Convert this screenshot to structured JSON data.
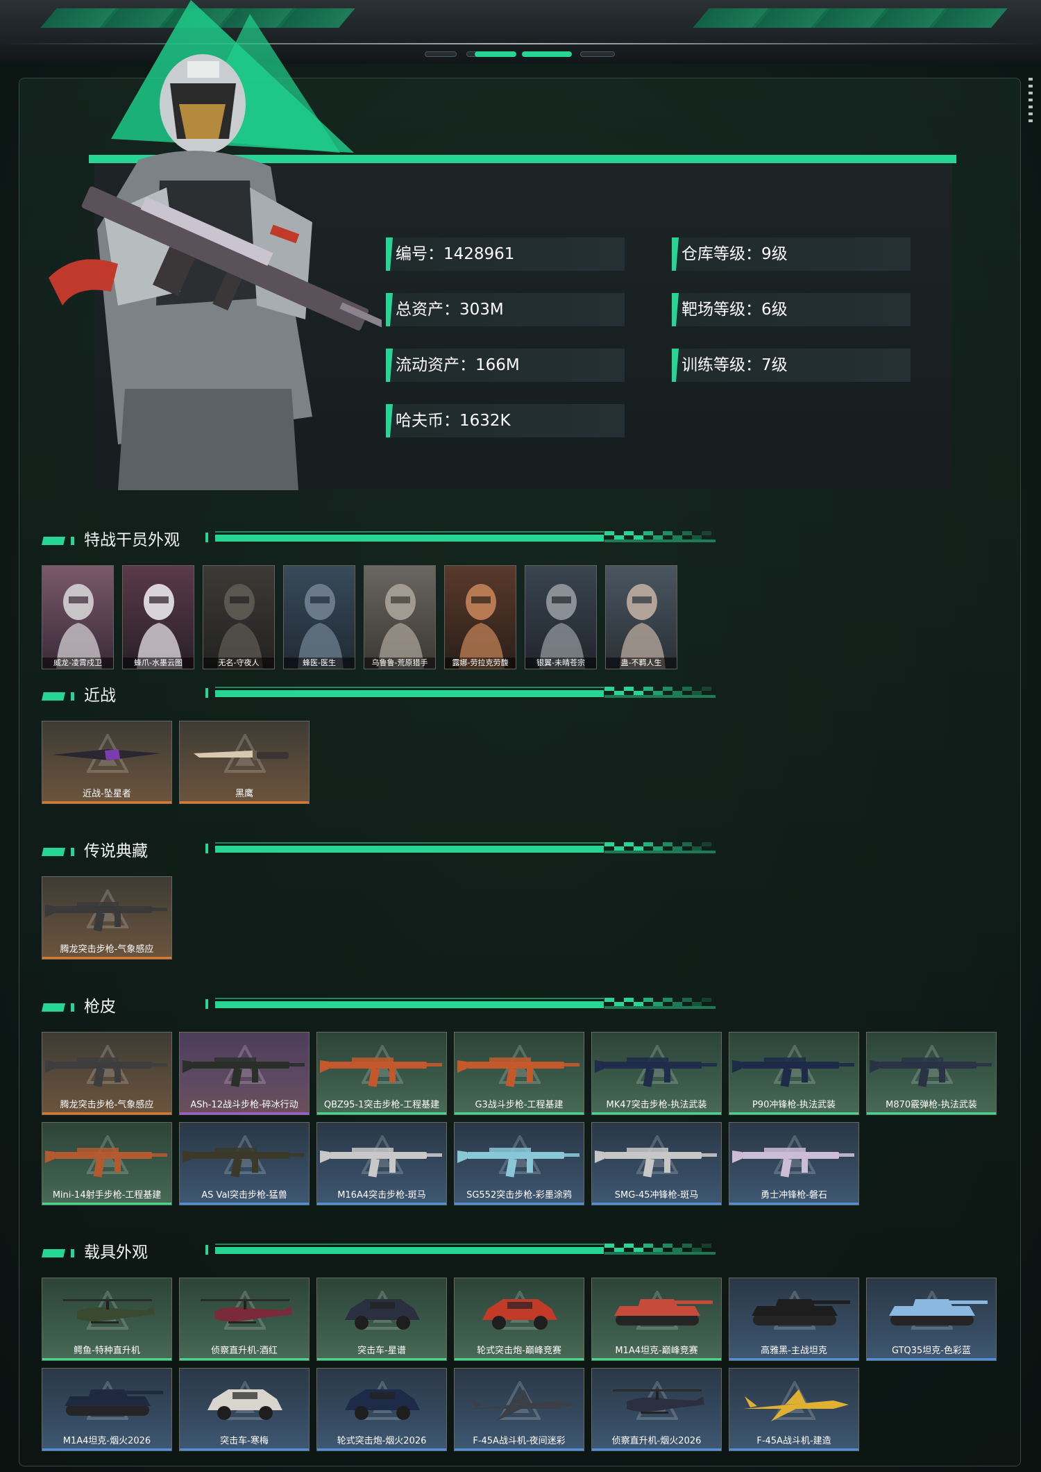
{
  "profile": {
    "stats": [
      {
        "label": "编号：1428961"
      },
      {
        "label": "仓库等级：9级"
      },
      {
        "label": "总资产：303M"
      },
      {
        "label": "靶场等级：6级"
      },
      {
        "label": "流动资产：166M"
      },
      {
        "label": "训练等级：7级"
      },
      {
        "label": "哈夫币：1632K"
      }
    ]
  },
  "sections": {
    "operators": {
      "title": "特战干员外观",
      "items": [
        "威龙-凌霄戍卫",
        "蜂爪-水墨云图",
        "无名-守夜人",
        "蜂医-医生",
        "乌鲁鲁-荒原猎手",
        "露娜-劳拉克劳馥",
        "银翼-未晴苍宗",
        "蛊-不羁人生"
      ]
    },
    "melee": {
      "title": "近战",
      "items": [
        "近战-坠星者",
        "黑鹰"
      ]
    },
    "legend": {
      "title": "传说典藏",
      "items": [
        "腾龙突击步枪-气象感应"
      ]
    },
    "skins": {
      "title": "枪皮",
      "items": [
        {
          "name": "腾龙突击步枪-气象感应",
          "tier": "gold"
        },
        {
          "name": "ASh-12战斗步枪-碎冰行动",
          "tier": "purple"
        },
        {
          "name": "QBZ95-1突击步枪-工程基建",
          "tier": "green"
        },
        {
          "name": "G3战斗步枪-工程基建",
          "tier": "green"
        },
        {
          "name": "MK47突击步枪-执法武装",
          "tier": "green"
        },
        {
          "name": "P90冲锋枪-执法武装",
          "tier": "green"
        },
        {
          "name": "M870霰弹枪-执法武装",
          "tier": "green"
        },
        {
          "name": "Mini-14射手步枪-工程基建",
          "tier": "green"
        },
        {
          "name": "AS Val突击步枪-猛兽",
          "tier": "blue"
        },
        {
          "name": "M16A4突击步枪-斑马",
          "tier": "blue"
        },
        {
          "name": "SG552突击步枪-彩墨涂鸦",
          "tier": "blue"
        },
        {
          "name": "SMG-45冲锋枪-斑马",
          "tier": "blue"
        },
        {
          "name": "勇士冲锋枪-磐石",
          "tier": "blue"
        }
      ]
    },
    "vehicles": {
      "title": "载具外观",
      "items": [
        {
          "name": "鳄鱼-特种直升机",
          "tier": "green"
        },
        {
          "name": "侦察直升机-酒红",
          "tier": "green"
        },
        {
          "name": "突击车-星谱",
          "tier": "green"
        },
        {
          "name": "轮式突击炮-巅峰竞赛",
          "tier": "green"
        },
        {
          "name": "M1A4坦克-巅峰竞赛",
          "tier": "green"
        },
        {
          "name": "高雅黑-主战坦克",
          "tier": "blue"
        },
        {
          "name": "GTQ35坦克-色彩蓝",
          "tier": "blue"
        },
        {
          "name": "M1A4坦克-烟火2026",
          "tier": "blue"
        },
        {
          "name": "突击车-寒梅",
          "tier": "blue"
        },
        {
          "name": "轮式突击炮-烟火2026",
          "tier": "blue"
        },
        {
          "name": "F-45A战斗机-夜间迷彩",
          "tier": "blue"
        },
        {
          "name": "侦察直升机-烟火2026",
          "tier": "blue"
        },
        {
          "name": "F-45A战斗机-建造",
          "tier": "blue"
        }
      ]
    }
  },
  "colors": {
    "accent": "#27d695",
    "gold_line": "#e0782a",
    "green_line": "#3fd98f",
    "blue_line": "#4d8fe0",
    "purple_line": "#a35ad6"
  }
}
